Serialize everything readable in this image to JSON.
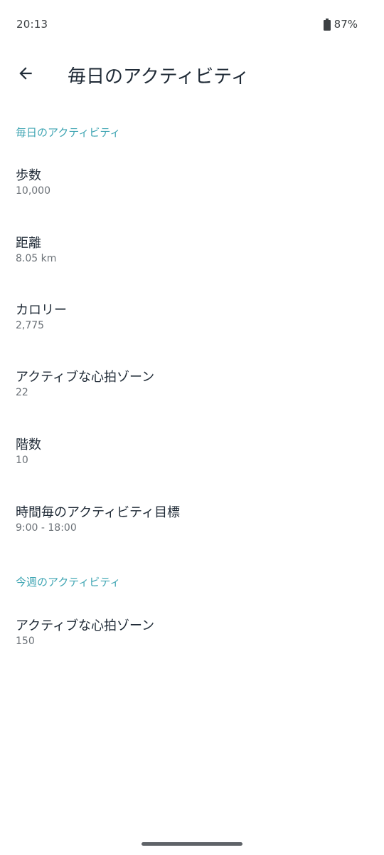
{
  "status_bar": {
    "time": "20:13",
    "battery_percent": "87%",
    "battery_icon": "battery-icon"
  },
  "app_bar": {
    "back_icon": "arrow-back-icon",
    "title": "毎日のアクティビティ"
  },
  "sections": [
    {
      "header": "毎日のアクティビティ",
      "items": [
        {
          "title": "歩数",
          "summary": "10,000"
        },
        {
          "title": "距離",
          "summary": "8.05 km"
        },
        {
          "title": "カロリー",
          "summary": "2,775"
        },
        {
          "title": "アクティブな心拍ゾーン",
          "summary": "22"
        },
        {
          "title": "階数",
          "summary": "10"
        },
        {
          "title": "時間毎のアクティビティ目標",
          "summary": "9:00 - 18:00"
        }
      ]
    },
    {
      "header": "今週のアクティビティ",
      "items": [
        {
          "title": "アクティブな心拍ゾーン",
          "summary": "150"
        }
      ]
    }
  ],
  "colors": {
    "accent": "#3fa5b3",
    "title_text": "#1f2a36",
    "summary_text": "#6b7177"
  }
}
